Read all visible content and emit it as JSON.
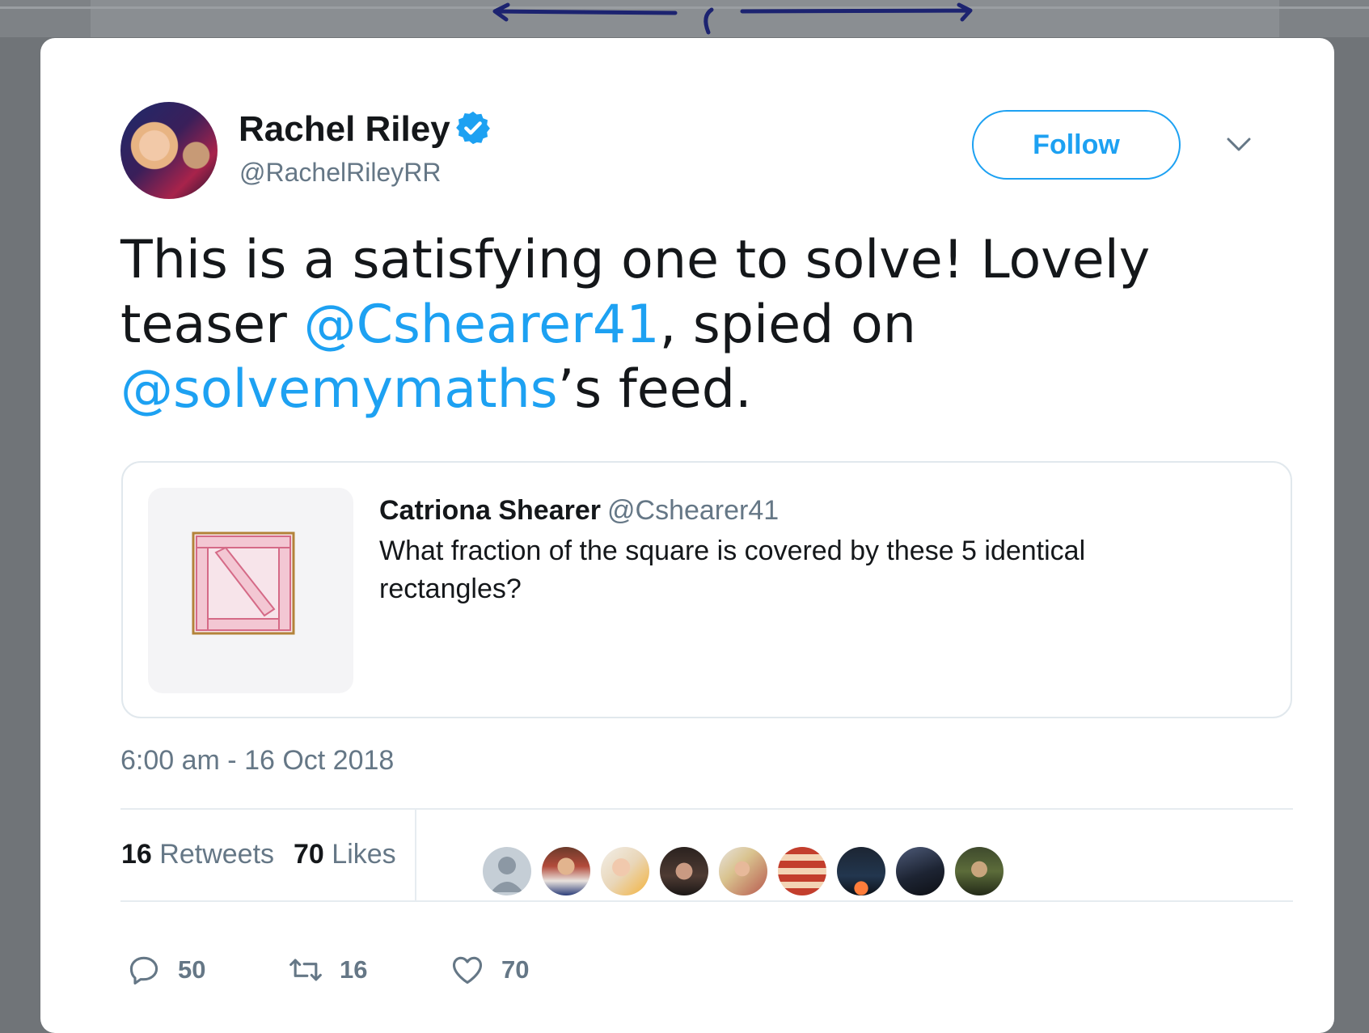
{
  "author": {
    "name": "Rachel Riley",
    "handle": "@RachelRileyRR",
    "verified": true
  },
  "follow_label": "Follow",
  "tweet": {
    "text_1": "This is a satisfying one to solve! Lovely teaser ",
    "mention_1": "@Cshearer41",
    "text_2": ", spied on ",
    "mention_2": "@solvemymaths",
    "text_3": "’s feed."
  },
  "quote": {
    "name": "Catriona Shearer",
    "handle": "@Cshearer41",
    "text": "What fraction of the square is covered by these 5 identical rectangles?"
  },
  "timestamp": "6:00 am - 16 Oct 2018",
  "stats": {
    "retweets_count": "16",
    "retweets_label": "Retweets",
    "likes_count": "70",
    "likes_label": "Likes"
  },
  "liker_avatar_count_shown": 9,
  "actions": {
    "reply_count": "50",
    "retweet_count": "16",
    "like_count": "70"
  },
  "colors": {
    "accent": "#1da1f2",
    "text": "#14171a",
    "muted": "#657786",
    "border": "#e1e8ed"
  },
  "icons": [
    "verified-icon",
    "chevron-down-icon",
    "reply-icon",
    "retweet-icon",
    "heart-icon"
  ]
}
